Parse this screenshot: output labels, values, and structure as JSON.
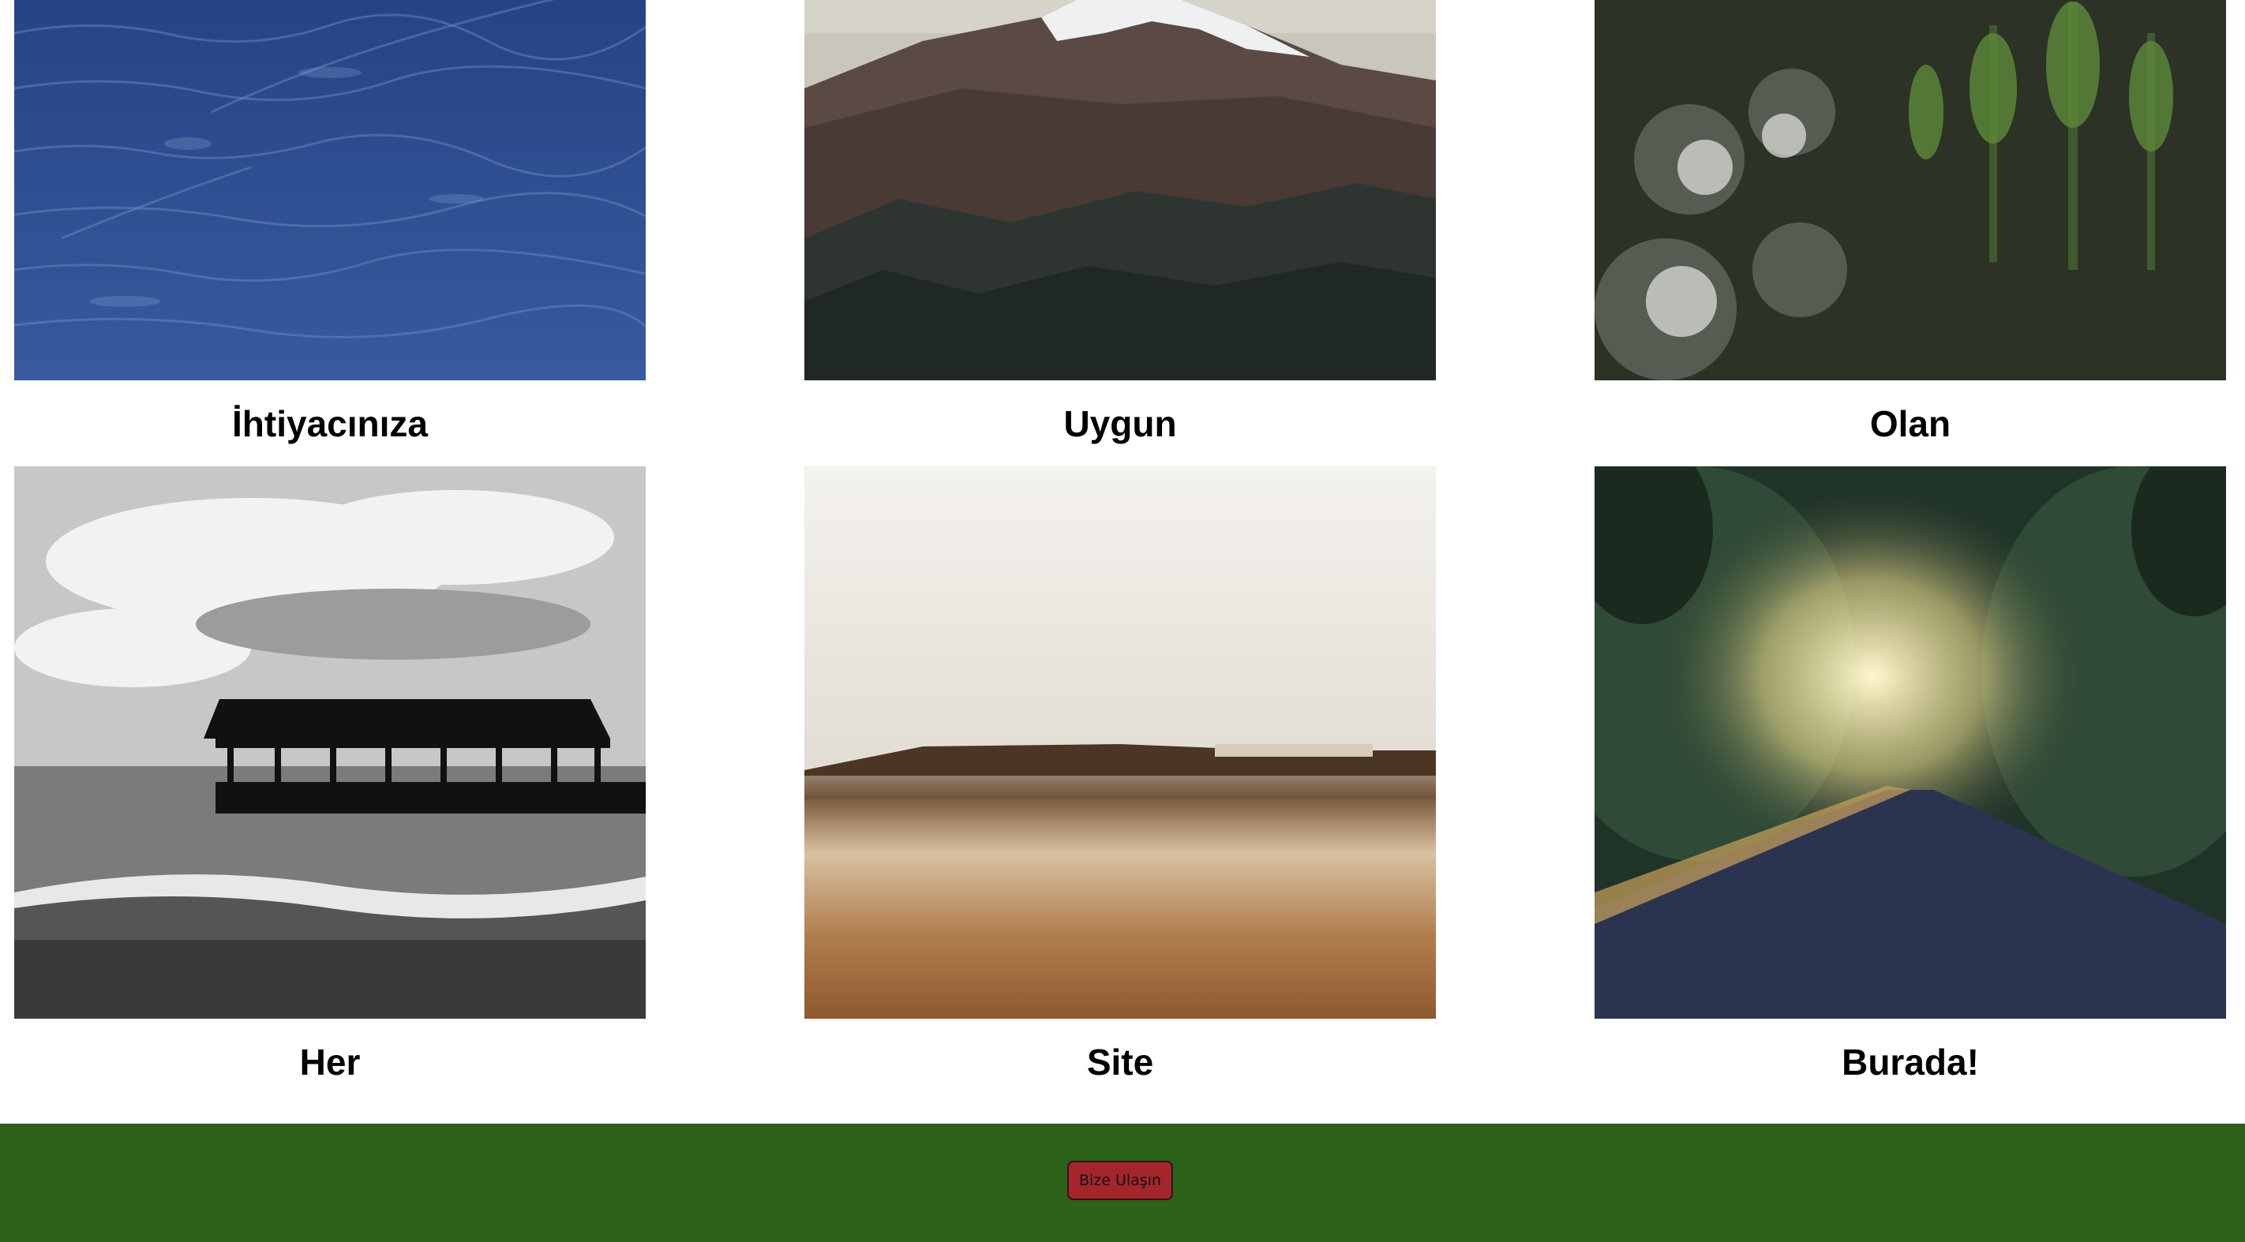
{
  "gallery": {
    "items": [
      {
        "caption": "İhtiyacınıza",
        "image": "ocean-water-photo"
      },
      {
        "caption": "Uygun",
        "image": "snowy-mountain-photo"
      },
      {
        "caption": "Olan",
        "image": "forest-flowers-photo"
      },
      {
        "caption": "Her",
        "image": "pier-black-white-photo"
      },
      {
        "caption": "Site",
        "image": "sepia-beach-photo"
      },
      {
        "caption": "Burada!",
        "image": "sunlit-road-photo"
      }
    ]
  },
  "footer": {
    "contact_label": "Bize Ulaşın",
    "background_color": "#2c611a",
    "button_color": "#a4262c"
  }
}
